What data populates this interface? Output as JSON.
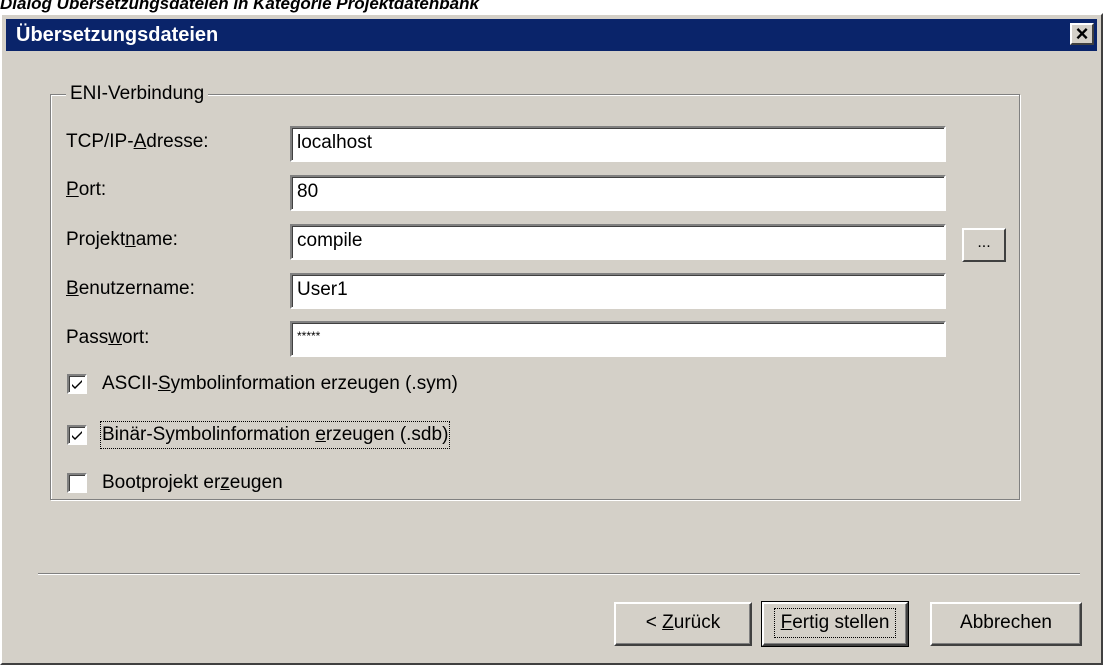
{
  "caption": "Dialog Übersetzungsdateien in Kategorie Projektdatenbank",
  "window": {
    "title": "Übersetzungsdateien",
    "close_glyph": "×"
  },
  "group": {
    "title": "ENI-Verbindung"
  },
  "fields": {
    "address": {
      "label_pre": "TCP/IP-",
      "label_accel": "A",
      "label_post": "dresse:",
      "value": "localhost"
    },
    "port": {
      "label_pre": "",
      "label_accel": "P",
      "label_post": "ort:",
      "value": "80"
    },
    "project": {
      "label_pre": "Projekt",
      "label_accel": "n",
      "label_post": "ame:",
      "value": "compile"
    },
    "user": {
      "label_pre": "",
      "label_accel": "B",
      "label_post": "enutzername:",
      "value": "User1"
    },
    "password": {
      "label_pre": "Pass",
      "label_accel": "w",
      "label_post": "ort:",
      "value": "*****"
    }
  },
  "browse_button": {
    "label": "..."
  },
  "checkboxes": {
    "ascii": {
      "label_pre": "ASCII-",
      "label_accel": "S",
      "label_post": "ymbolinformation erzeugen (.sym)",
      "checked": true
    },
    "binary": {
      "label_pre": "Binär-Symbolinformation ",
      "label_accel": "e",
      "label_post": "rzeugen (.sdb)",
      "checked": true
    },
    "boot": {
      "label_pre": "Bootprojekt er",
      "label_accel": "z",
      "label_post": "eugen",
      "checked": false
    }
  },
  "buttons": {
    "back": {
      "label_pre": "< ",
      "label_accel": "Z",
      "label_post": "urück"
    },
    "finish": {
      "label_pre": "",
      "label_accel": "F",
      "label_post": "ertig stellen"
    },
    "cancel": {
      "label": "Abbrechen"
    }
  },
  "icons": {
    "close": "close-icon",
    "checkmark": "checkmark-icon"
  }
}
